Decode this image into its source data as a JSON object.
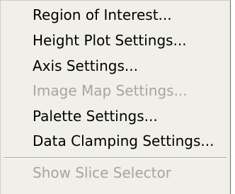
{
  "menu": {
    "items": [
      {
        "label": "Region of Interest...",
        "enabled": true
      },
      {
        "label": "Height Plot Settings...",
        "enabled": true
      },
      {
        "label": "Axis Settings...",
        "enabled": true
      },
      {
        "label": "Image Map Settings...",
        "enabled": false
      },
      {
        "label": "Palette Settings...",
        "enabled": true
      },
      {
        "label": "Data Clamping Settings...",
        "enabled": true
      }
    ],
    "slice_item": {
      "label": "Show Slice Selector",
      "enabled": false
    }
  },
  "colors": {
    "menu_background": "#f0efe9",
    "enabled_text": "#000000",
    "disabled_text": "#a7a59c"
  }
}
